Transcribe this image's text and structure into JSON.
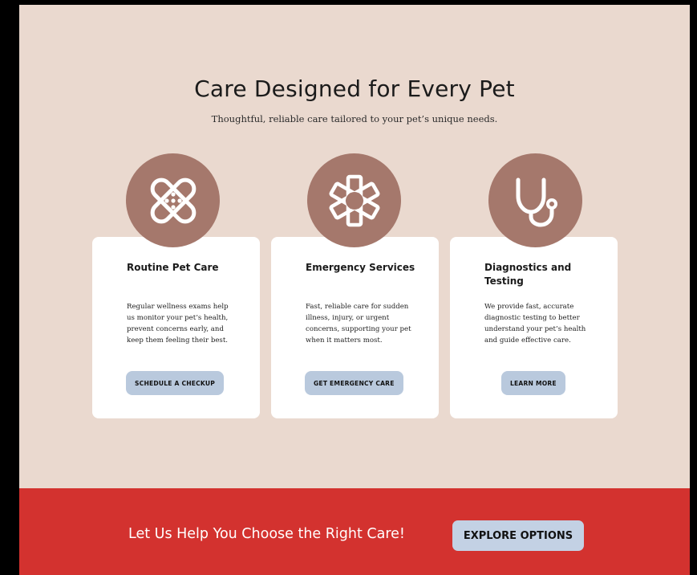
{
  "hero": {
    "title": "Care Designed for Every Pet",
    "subtitle": "Thoughtful, reliable care tailored to your pet’s unique needs."
  },
  "cards": [
    {
      "icon": "bandage-icon",
      "title": "Routine Pet Care",
      "text": "Regular wellness exams help us monitor your pet’s health, prevent concerns early, and keep them feeling their best.",
      "button": "SCHEDULE A CHECKUP"
    },
    {
      "icon": "medical-star-icon",
      "title": "Emergency Services",
      "text": "Fast, reliable care for sudden illness, injury, or urgent concerns, supporting your pet when it matters most.",
      "button": "GET EMERGENCY CARE"
    },
    {
      "icon": "stethoscope-icon",
      "title": "Diagnostics and Testing",
      "text": "We provide fast, accurate diagnostic testing to better understand your pet’s health and guide effective care.",
      "button": "LEARN MORE"
    }
  ],
  "cta": {
    "text": "Let Us Help You Choose the Right Care!",
    "button": "EXPLORE OPTIONS"
  },
  "colors": {
    "background": "#ead9cf",
    "icon_circle": "#a5786c",
    "button": "#b9c9dd",
    "cta_band": "#d3322f"
  }
}
